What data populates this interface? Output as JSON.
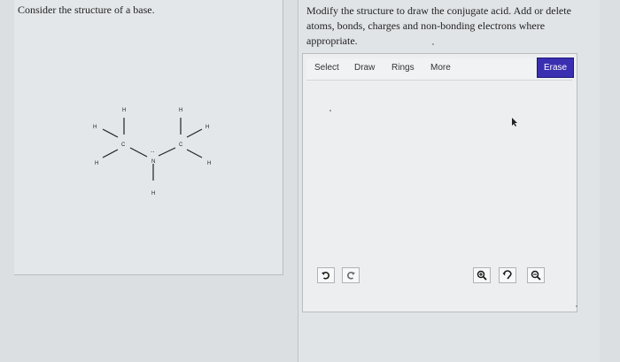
{
  "left_panel": {
    "prompt": "Consider the structure of a base.",
    "molecule": {
      "atoms": [
        "H",
        "H",
        "H",
        "C",
        "N",
        "C",
        "H",
        "H",
        "H",
        "H"
      ],
      "lone_pair": ".."
    }
  },
  "right_panel": {
    "prompt": "Modify the structure to draw the conjugate acid. Add or delete atoms, bonds, charges and non-bonding electrons where appropriate."
  },
  "toolbar": {
    "select_label": "Select",
    "draw_label": "Draw",
    "rings_label": "Rings",
    "more_label": "More",
    "erase_label": "Erase"
  },
  "bottom_toolbar": {
    "icons": [
      "undo-icon",
      "redo-icon",
      "zoom-in-icon",
      "reset-view-icon",
      "zoom-out-icon"
    ]
  },
  "colors": {
    "erase_button": "#3a2fb1",
    "page_background": "#dcdfe2"
  }
}
